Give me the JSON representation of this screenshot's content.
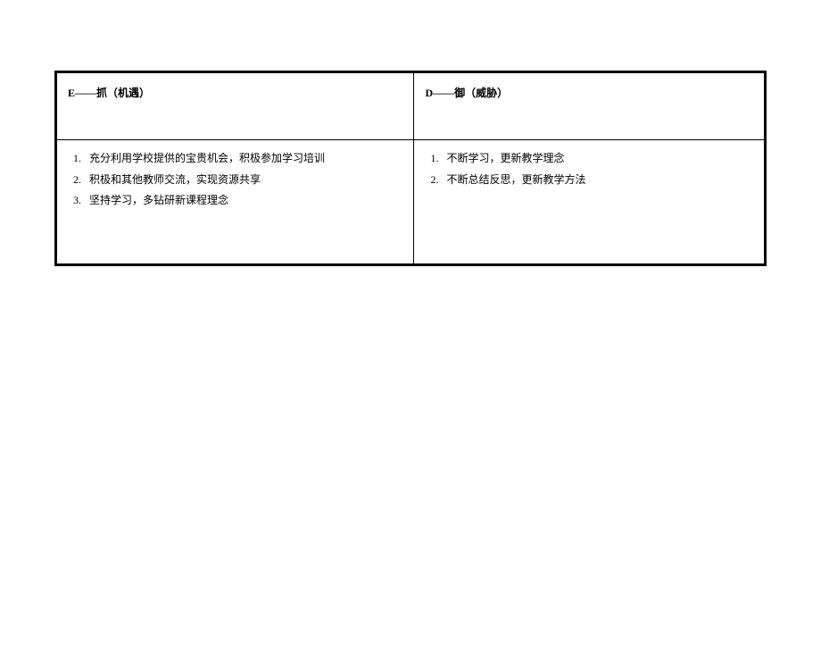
{
  "table": {
    "headers": {
      "left": "E——抓（机遇）",
      "right": "D——御（威胁）"
    },
    "rows": {
      "left": [
        "充分利用学校提供的宝贵机会，积极参加学习培训",
        "积极和其他教师交流，实现资源共享",
        "坚持学习，多钻研新课程理念"
      ],
      "right": [
        "不断学习，更新教学理念",
        "不断总结反思，更新教学方法"
      ]
    }
  }
}
